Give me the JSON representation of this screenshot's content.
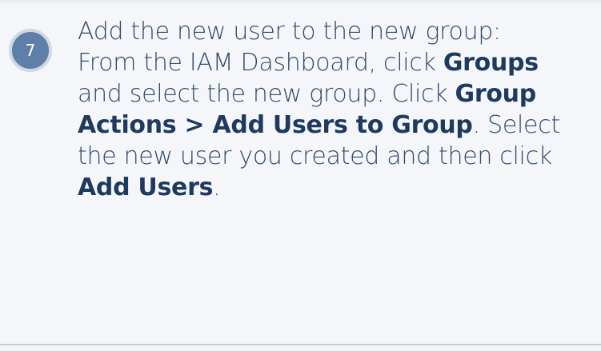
{
  "step": {
    "number": "7",
    "lines": [
      {
        "segments": [
          {
            "text": "Add the new user to the new group:",
            "bold": false
          }
        ]
      },
      {
        "segments": [
          {
            "text": "From the IAM Dashboard, click ",
            "bold": false
          },
          {
            "text": "Groups",
            "bold": true
          }
        ]
      },
      {
        "segments": [
          {
            "text": "and select the new group. Click ",
            "bold": false
          },
          {
            "text": "Group",
            "bold": true
          }
        ]
      },
      {
        "segments": [
          {
            "text": "Actions > Add Users to Group",
            "bold": true
          },
          {
            "text": ". Select",
            "bold": false
          }
        ]
      },
      {
        "segments": [
          {
            "text": "the new user you created and then click",
            "bold": false
          }
        ]
      },
      {
        "segments": [
          {
            "text": "Add Users",
            "bold": true
          },
          {
            "text": ".",
            "bold": false
          }
        ]
      }
    ]
  },
  "colors": {
    "background": "#f4f6f9",
    "text": "#344b6a",
    "badge": "#5d7fa8",
    "badge_ring": "#cfd9e5",
    "divider": "#c8cdd4"
  }
}
